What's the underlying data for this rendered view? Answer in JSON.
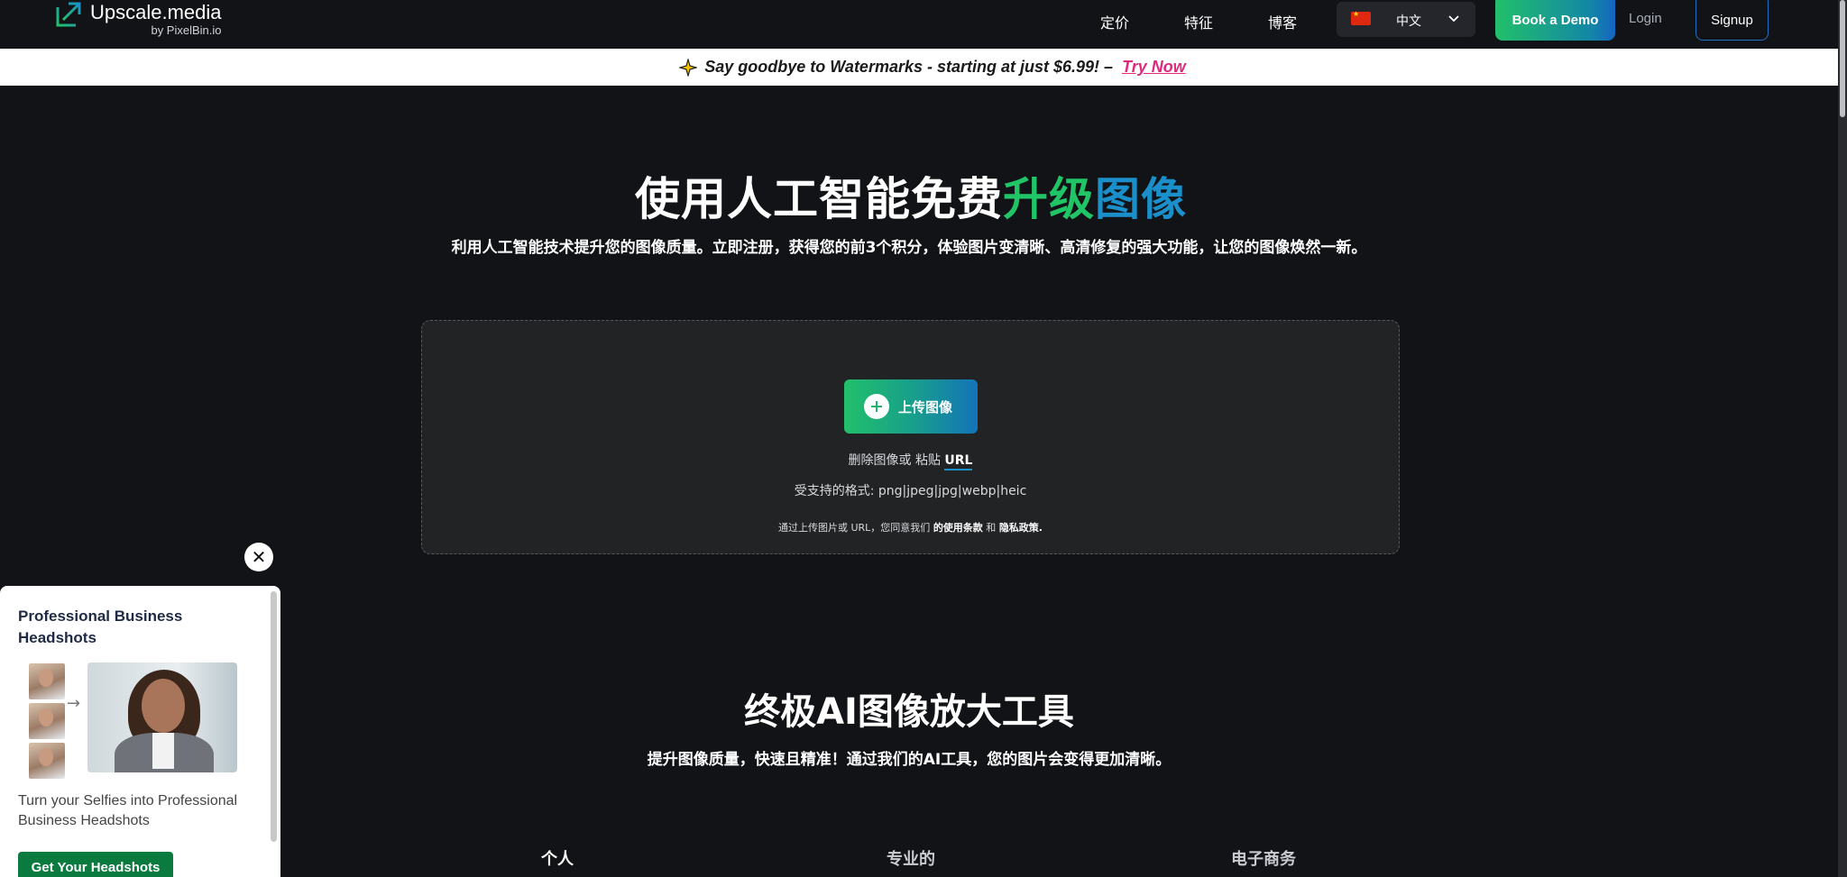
{
  "nav": {
    "logo_title": "Upscale.media",
    "logo_sub": "by PixelBin.io",
    "links": [
      "定价",
      "特征",
      "博客"
    ],
    "language": "中文",
    "demo_label": "Book a Demo",
    "login_label": "Login",
    "signup_label": "Signup"
  },
  "promo": {
    "text": "Say goodbye to Watermarks - starting at just $6.99! –",
    "link": "Try Now"
  },
  "hero": {
    "title_plain": "使用人工智能免费",
    "title_green": "升级",
    "title_blue": "图像",
    "subtitle": "利用人工智能技术提升您的图像质量。立即注册，获得您的前3个积分，体验图片变清晰、高清修复的强大功能，让您的图像焕然一新。"
  },
  "upload": {
    "button_label": "上传图像",
    "drop_prefix": "删除图像或 粘贴 ",
    "drop_url": "URL",
    "formats": "受支持的格式:  png|jpeg|jpg|webp|heic",
    "terms_prefix": "通过上传图片或 URL，您同意我们 ",
    "terms_link": "的使用条款",
    "terms_mid": " 和 ",
    "privacy_link": "隐私政策."
  },
  "section": {
    "title": "终极AI图像放大工具",
    "subtitle": "提升图像质量，快速且精准！通过我们的AI工具，您的图片会变得更加清晰。",
    "tabs": [
      "个人",
      "专业的",
      "电子商务"
    ]
  },
  "popup": {
    "close": "✕",
    "title": "Professional Business Headshots",
    "arrow": "→",
    "description": "Turn your Selfies into Professional Business Headshots",
    "cta": "Get Your Headshots"
  },
  "colors": {
    "accent_green": "#21c466",
    "accent_blue": "#1a8fc9",
    "promo_link": "#e0287f",
    "cta_green": "#0b7a3e"
  }
}
